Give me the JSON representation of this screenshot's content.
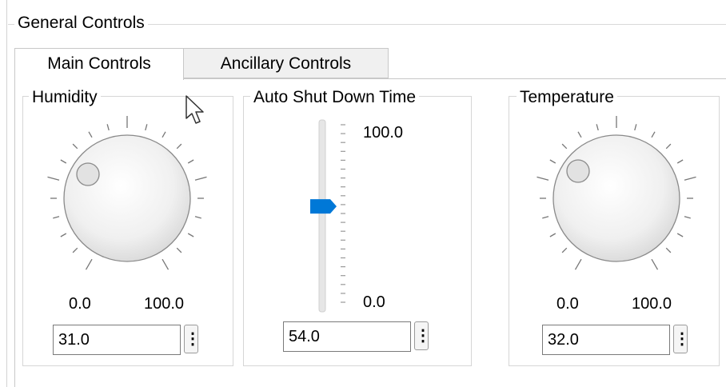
{
  "group": {
    "title": "General Controls"
  },
  "tabs": [
    {
      "label": "Main Controls",
      "active": true
    },
    {
      "label": "Ancillary Controls",
      "active": false
    }
  ],
  "humidity": {
    "title": "Humidity",
    "min_label": "0.0",
    "max_label": "100.0",
    "value": "31.0",
    "value_fraction": 0.31
  },
  "shutdown": {
    "title": "Auto Shut Down Time",
    "max_label": "100.0",
    "min_label": "0.0",
    "value": "54.0",
    "value_fraction": 0.54
  },
  "temperature": {
    "title": "Temperature",
    "min_label": "0.0",
    "max_label": "100.0",
    "value": "32.0",
    "value_fraction": 0.32
  },
  "colors": {
    "accent": "#0078d7",
    "border": "#d6d6d6"
  }
}
